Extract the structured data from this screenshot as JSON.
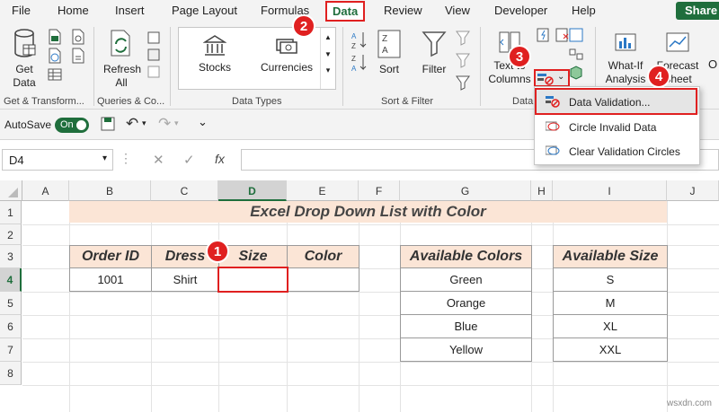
{
  "menu": {
    "file": "File",
    "home": "Home",
    "insert": "Insert",
    "page_layout": "Page Layout",
    "formulas": "Formulas",
    "data": "Data",
    "review": "Review",
    "view": "View",
    "developer": "Developer",
    "help": "Help",
    "share": "Share"
  },
  "ribbon": {
    "get_data": "Get Data",
    "refresh_all": "Refresh All",
    "stocks": "Stocks",
    "currencies": "Currencies",
    "sort": "Sort",
    "filter": "Filter",
    "text_to_columns": "Text to Columns",
    "whatif": "What-If Analysis",
    "forecast_sheet": "Forecast Sheet",
    "groups": {
      "get_transform": "Get & Transform...",
      "queries": "Queries & Co...",
      "data_types": "Data Types",
      "sort_filter": "Sort & Filter",
      "data_tools": "Data"
    }
  },
  "qat": {
    "autosave": "AutoSave",
    "toggle": "On"
  },
  "formula_bar": {
    "name_box": "D4",
    "fx": "fx",
    "value": ""
  },
  "columns": [
    "A",
    "B",
    "C",
    "D",
    "E",
    "F",
    "G",
    "H",
    "I",
    "J"
  ],
  "rows": [
    "1",
    "2",
    "3",
    "4",
    "5",
    "6",
    "7",
    "8"
  ],
  "sheet": {
    "title": "Excel Drop Down List with Color",
    "order_table": {
      "headers": [
        "Order ID",
        "Dress",
        "Size",
        "Color"
      ],
      "row": [
        "1001",
        "Shirt",
        "",
        ""
      ]
    },
    "colors_table": {
      "header": "Available Colors",
      "items": [
        "Green",
        "Orange",
        "Blue",
        "Yellow"
      ]
    },
    "size_table": {
      "header": "Available Size",
      "items": [
        "S",
        "M",
        "XL",
        "XXL"
      ]
    }
  },
  "dropdown": {
    "items": [
      "Data Validation...",
      "Circle Invalid Data",
      "Clear Validation Circles"
    ]
  },
  "callouts": [
    "1",
    "2",
    "3",
    "4"
  ],
  "watermark": "wsxdn.com",
  "colors": {
    "accent": "#1f6e3c",
    "callout": "#e02020",
    "header_fill": "#fbe5d6"
  }
}
